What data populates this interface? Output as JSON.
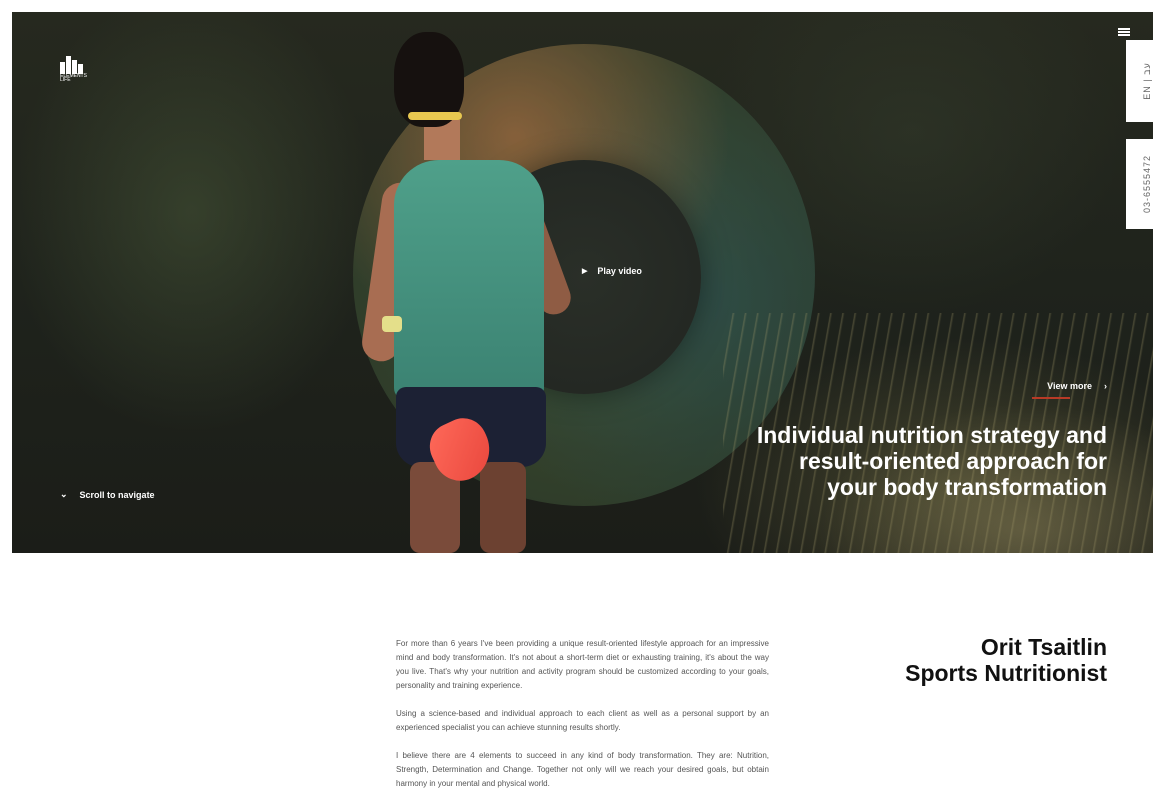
{
  "brand": {
    "logo_text": "ELEMENTS LIFE"
  },
  "header": {
    "menu_icon": "hamburger-icon"
  },
  "side": {
    "lang": "EN | עב",
    "phone": "03-6555472"
  },
  "hero": {
    "play_label": "Play video",
    "view_more_label": "View more",
    "view_more_arrow": "›",
    "headline": [
      "Individual nutrition strategy and",
      "result-oriented approach for",
      "your body transformation"
    ],
    "scroll_label": "Scroll to navigate",
    "scroll_chevron": "⌄"
  },
  "about": {
    "paragraphs": [
      "For more than 6 years I've been providing a unique result-oriented lifestyle approach for an impressive mind and body transformation. It's not about a short-term diet or exhausting training, it's about the way you live. That's why your nutrition and activity program should be customized according to your goals, personality and training experience.",
      "Using a science-based and individual approach to each client as well as a personal support by an experienced specialist you can achieve stunning results shortly.",
      "I believe there are 4 elements to succeed in any kind of body transformation. They are: Nutrition, Strength, Determination and Change. Together not only will we reach your desired goals, but obtain harmony in your mental and physical world."
    ],
    "name": "Orit Tsaitlin",
    "role": "Sports Nutritionist"
  },
  "colors": {
    "accent_line": "#b83a26",
    "panel_bg": "#ffffff"
  }
}
